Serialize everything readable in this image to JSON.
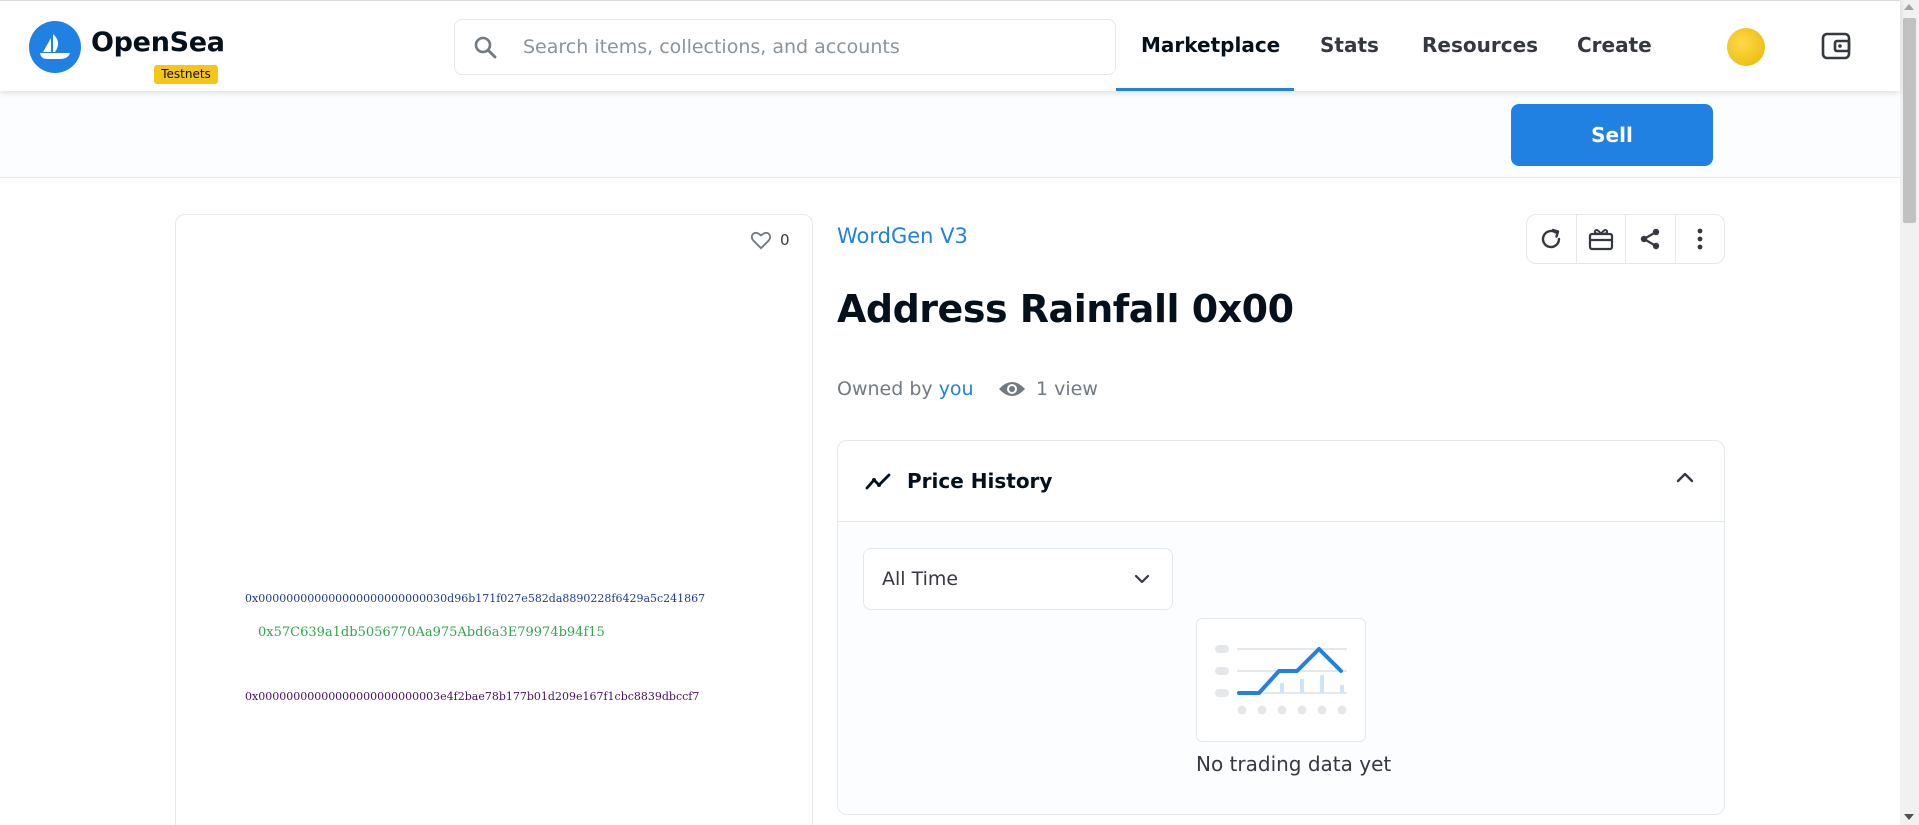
{
  "header": {
    "brand": "OpenSea",
    "badge": "Testnets",
    "search_placeholder": "Search items, collections, and accounts",
    "nav": [
      "Marketplace",
      "Stats",
      "Resources",
      "Create"
    ],
    "active_nav": "Marketplace"
  },
  "toolbar": {
    "sell_label": "Sell"
  },
  "asset": {
    "likes": "0",
    "collection": "WordGen V3",
    "title": "Address Rainfall 0x00",
    "owned_prefix": "Owned by",
    "owner": "you",
    "views": "1 view",
    "image_lines": [
      "0x000000000000000000000000030d96b171f027e582da8890228f6429a5c241867",
      "0x57C639a1db5056770Aa975Abd6a3E79974b94f15",
      "0x00000000000000000000000003e4f2bae78b177b01d209e167f1cbc8839dbccf7"
    ]
  },
  "price_history": {
    "title": "Price History",
    "range_selected": "All Time",
    "empty_text": "No trading data yet"
  },
  "colors": {
    "accent": "#2081e2",
    "badge": "#f5c518",
    "text_dark": "#04111d",
    "text_muted": "#707a83"
  },
  "icons": {
    "logo": "opensea-ship-icon",
    "search": "search-icon",
    "wallet": "wallet-icon",
    "refresh": "refresh-icon",
    "transfer": "gift-icon",
    "share": "share-icon",
    "more": "more-vertical-icon",
    "like": "heart-icon",
    "views": "eye-icon",
    "price_history": "trend-line-icon",
    "collapse": "chevron-up-icon",
    "dropdown": "chevron-down-icon"
  }
}
